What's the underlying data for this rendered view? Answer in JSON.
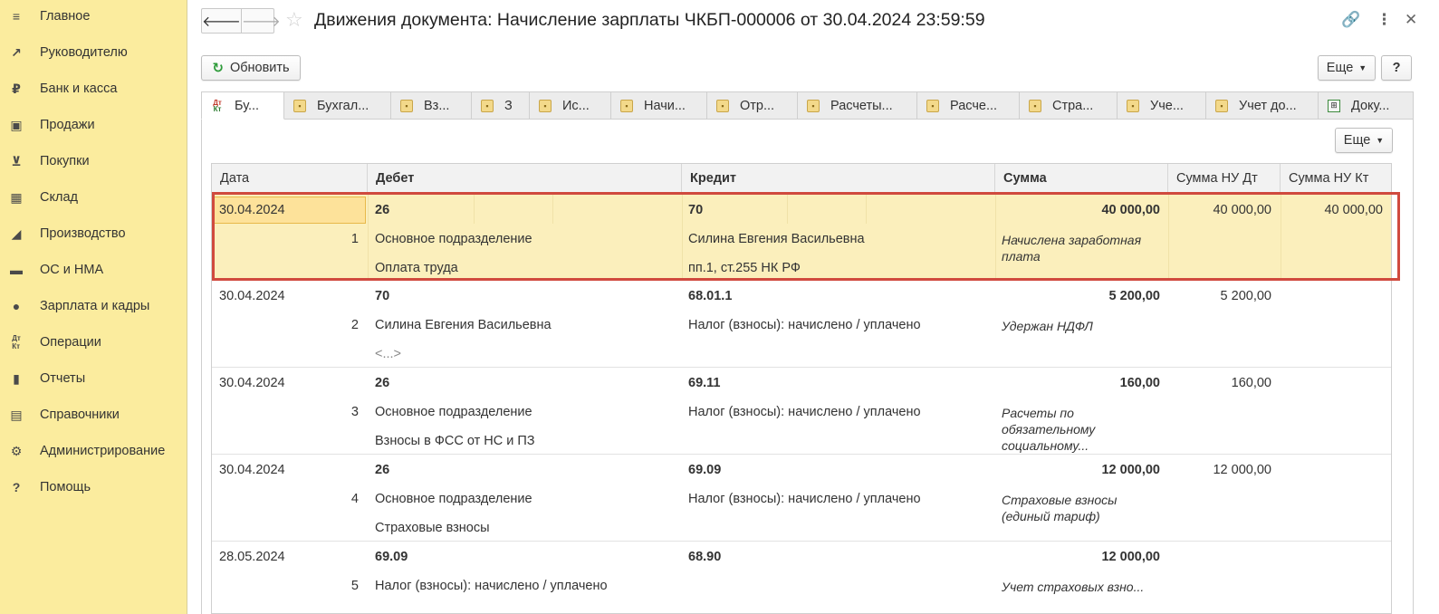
{
  "sidebar": {
    "items": [
      {
        "label": "Главное"
      },
      {
        "label": "Руководителю"
      },
      {
        "label": "Банк и касса"
      },
      {
        "label": "Продажи"
      },
      {
        "label": "Покупки"
      },
      {
        "label": "Склад"
      },
      {
        "label": "Производство"
      },
      {
        "label": "ОС и НМА"
      },
      {
        "label": "Зарплата и кадры"
      },
      {
        "label": "Операции"
      },
      {
        "label": "Отчеты"
      },
      {
        "label": "Справочники"
      },
      {
        "label": "Администрирование"
      },
      {
        "label": "Помощь"
      }
    ]
  },
  "header": {
    "title": "Движения документа: Начисление зарплаты ЧКБП-000006 от 30.04.2024 23:59:59"
  },
  "toolbar": {
    "refresh_label": "Обновить",
    "more_label": "Еще",
    "help_label": "?",
    "panel_more_label": "Еще"
  },
  "tabs": [
    {
      "label": "Бу..."
    },
    {
      "label": "Бухгал..."
    },
    {
      "label": "Вз..."
    },
    {
      "label": "З"
    },
    {
      "label": "Ис..."
    },
    {
      "label": "Начи..."
    },
    {
      "label": "Отр..."
    },
    {
      "label": "Расчеты..."
    },
    {
      "label": "Расче..."
    },
    {
      "label": "Стра..."
    },
    {
      "label": "Уче..."
    },
    {
      "label": "Учет до..."
    },
    {
      "label": "Доку..."
    }
  ],
  "table": {
    "columns": [
      "Дата",
      "Дебет",
      "Кредит",
      "Сумма",
      "Сумма НУ Дт",
      "Сумма НУ Кт"
    ],
    "rows": [
      {
        "date": "30.04.2024",
        "num": "1",
        "debit": "26",
        "debit_sub1": "Основное подразделение",
        "debit_sub2": "Оплата труда",
        "credit": "70",
        "credit_sub1": "Силина Евгения Васильевна",
        "credit_sub2": "пп.1, ст.255 НК РФ",
        "sum": "40 000,00",
        "content": "Начислена заработная плата",
        "nu_dt": "40 000,00",
        "nu_kt": "40 000,00"
      },
      {
        "date": "30.04.2024",
        "num": "2",
        "debit": "70",
        "debit_sub1": "Силина Евгения Васильевна",
        "debit_sub2": "<...>",
        "credit": "68.01.1",
        "credit_sub1": "Налог (взносы): начислено / уплачено",
        "credit_sub2": "",
        "sum": "5 200,00",
        "content": "Удержан НДФЛ",
        "nu_dt": "5 200,00",
        "nu_kt": ""
      },
      {
        "date": "30.04.2024",
        "num": "3",
        "debit": "26",
        "debit_sub1": "Основное подразделение",
        "debit_sub2": "Взносы в ФСС от НС и ПЗ",
        "credit": "69.11",
        "credit_sub1": "Налог (взносы): начислено / уплачено",
        "credit_sub2": "",
        "sum": "160,00",
        "content": "Расчеты по обязательному социальному...",
        "nu_dt": "160,00",
        "nu_kt": ""
      },
      {
        "date": "30.04.2024",
        "num": "4",
        "debit": "26",
        "debit_sub1": "Основное подразделение",
        "debit_sub2": "Страховые взносы",
        "credit": "69.09",
        "credit_sub1": "Налог (взносы): начислено / уплачено",
        "credit_sub2": "",
        "sum": "12 000,00",
        "content": "Страховые взносы (единый тариф)",
        "nu_dt": "12 000,00",
        "nu_kt": ""
      },
      {
        "date": "28.05.2024",
        "num": "5",
        "debit": "69.09",
        "debit_sub1": "Налог (взносы): начислено / уплачено",
        "debit_sub2": "",
        "credit": "68.90",
        "credit_sub1": "",
        "credit_sub2": "",
        "sum": "12 000,00",
        "content": "Учет страховых взно...",
        "nu_dt": "",
        "nu_kt": ""
      }
    ]
  }
}
